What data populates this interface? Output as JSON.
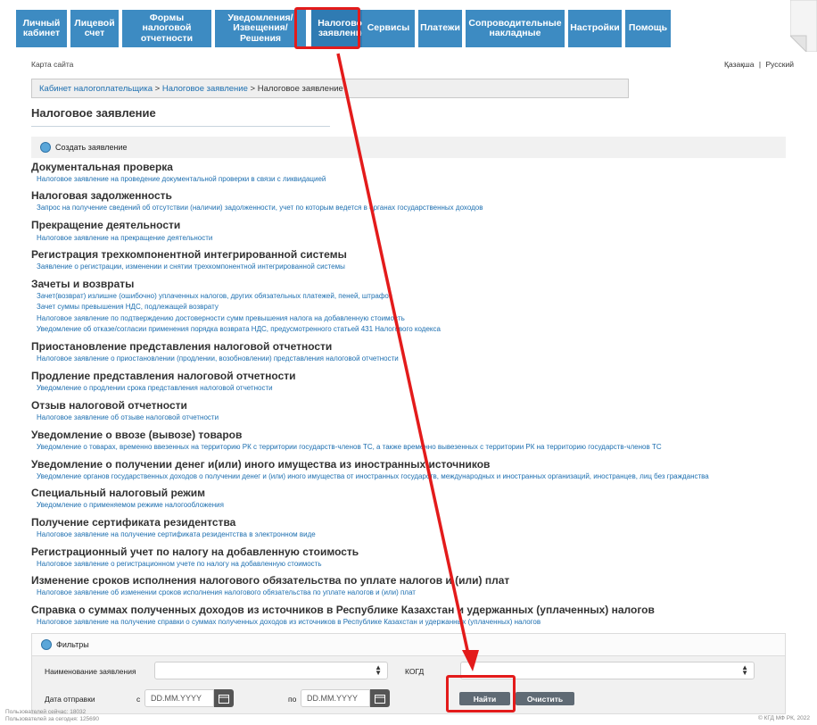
{
  "nav": [
    {
      "label": "Личный кабинет"
    },
    {
      "label": "Лицевой счет"
    },
    {
      "label": "Формы налоговой отчетности"
    },
    {
      "label": "Уведомления/ Извещения/ Решения"
    },
    {
      "label": "Налоговое заявление"
    },
    {
      "label": "Сервисы"
    },
    {
      "label": "Платежи"
    },
    {
      "label": "Сопроводительные накладные"
    },
    {
      "label": "Настройки"
    },
    {
      "label": "Помощь"
    }
  ],
  "sitemap": "Карта сайта",
  "lang": {
    "kz": "Қазақша",
    "sep": "|",
    "ru": "Русский"
  },
  "breadcrumb": {
    "item1": "Кабинет налогоплательщика",
    "item2": "Налоговое заявление",
    "current": "Налоговое заявление",
    "sep": ">"
  },
  "page_title": "Налоговое заявление",
  "create_label": "Создать заявление",
  "sections": [
    {
      "title": "Документальная проверка",
      "links": [
        "Налоговое заявление на проведение документальной проверки в связи с ликвидацией"
      ]
    },
    {
      "title": "Налоговая задолженность",
      "links": [
        "Запрос на получение сведений об отсутствии (наличии) задолженности, учет по которым ведется в органах государственных доходов"
      ]
    },
    {
      "title": "Прекращение деятельности",
      "links": [
        "Налоговое заявление на прекращение деятельности"
      ]
    },
    {
      "title": "Регистрация трехкомпонентной интегрированной системы",
      "links": [
        "Заявление о регистрации, изменении и снятии трехкомпонентной интегрированной системы"
      ]
    },
    {
      "title": "Зачеты и возвраты",
      "links": [
        "Зачет(возврат) излишне (ошибочно) уплаченных налогов, других обязательных платежей, пеней, штрафов",
        "Зачет суммы превышения НДС, подлежащей возврату",
        "Налоговое заявление по подтверждению достоверности сумм превышения налога на добавленную стоимость",
        "Уведомление об отказе/согласии применения порядка возврата НДС, предусмотренного статьей 431 Налогового кодекса"
      ]
    },
    {
      "title": "Приостановление представления налоговой отчетности",
      "links": [
        "Налоговое заявление о приостановлении (продлении, возобновлении) представления налоговой отчетности"
      ]
    },
    {
      "title": "Продление представления налоговой отчетности",
      "links": [
        "Уведомление о продлении срока представления налоговой отчетности"
      ]
    },
    {
      "title": "Отзыв налоговой отчетности",
      "links": [
        "Налоговое заявление об отзыве налоговой отчетности"
      ]
    },
    {
      "title": "Уведомление о ввозе (вывозе) товаров",
      "links": [
        "Уведомление о товарах, временно ввезенных на территорию РК с территории государств-членов ТС, а также временно вывезенных с территории РК на территорию государств-членов ТС"
      ]
    },
    {
      "title": "Уведомление о получении денег и(или) иного имущества из иностранных источников",
      "links": [
        "Уведомление органов государственных доходов о получении денег и (или) иного имущества от иностранных государств, международных и иностранных организаций, иностранцев, лиц без гражданства"
      ]
    },
    {
      "title": "Специальный налоговый режим",
      "links": [
        "Уведомление о применяемом режиме налогообложения"
      ]
    },
    {
      "title": "Получение сертификата резидентства",
      "links": [
        "Налоговое заявление на получение сертификата резидентства в электронном виде"
      ]
    },
    {
      "title": "Регистрационный учет по налогу на добавленную стоимость",
      "links": [
        "Налоговое заявление о регистрационном учете по налогу на добавленную стоимость"
      ]
    },
    {
      "title": "Изменение сроков исполнения налогового обязательства по уплате налогов и (или) плат",
      "links": [
        "Налоговое заявление об изменении сроков исполнения налогового обязательства по уплате налогов и (или) плат"
      ]
    },
    {
      "title": "Справка о суммах полученных доходов из источников в Республике Казахстан и удержанных (уплаченных) налогов",
      "links": [
        "Налоговое заявление на получение справки о суммах полученных доходов из источников в Республике Казахстан и удержанных (уплаченных) налогов"
      ]
    }
  ],
  "filters": {
    "title": "Фильтры",
    "name_label": "Наименование заявления",
    "kogd_label": "КОГД",
    "date_label": "Дата отправки",
    "from_label": "с",
    "to_label": "по",
    "date_from_placeholder": "DD.MM.YYYY",
    "date_to_placeholder": "DD.MM.YYYY",
    "search_button": "Найти",
    "clear_button": "Очистить"
  },
  "footer": {
    "online": "Пользователей сейчас: 18032",
    "today": "Пользователей за сегодня: 125690",
    "copyright": "© КГД МФ РК, 2022"
  },
  "colors": {
    "nav": "#3d8bc2",
    "link": "#1d6fb0",
    "annotation": "#e31b1b"
  }
}
